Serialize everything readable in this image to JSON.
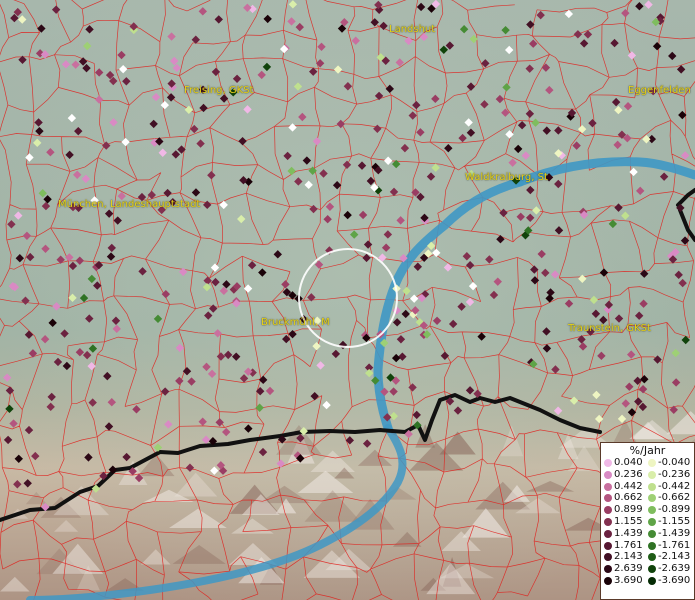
{
  "map": {
    "places": [
      {
        "name": "Landshut"
      },
      {
        "name": "Freising, GKSt"
      },
      {
        "name": "Eggenfelden"
      },
      {
        "name": "Waldkraiburg, St"
      },
      {
        "name": "München, Landeshauptstadt"
      },
      {
        "name": "Bruckmühl, M"
      },
      {
        "name": "Traunstein, GKSt"
      }
    ],
    "colors": {
      "background": "#9fb2a6",
      "district_lines": "#e0201c",
      "border_line": "#111111",
      "river": "#3f98c4",
      "label": "#e6d21a",
      "selection_circle": "#ffffff"
    }
  },
  "legend": {
    "title": "%/Jahr",
    "rows": [
      {
        "pos": "0.040",
        "pos_color": "#f0b8e6",
        "neg": "-0.040",
        "neg_color": "#eef5c2"
      },
      {
        "pos": "0.236",
        "pos_color": "#d98ac4",
        "neg": "-0.236",
        "neg_color": "#d9eeaa"
      },
      {
        "pos": "0.442",
        "pos_color": "#c9709f",
        "neg": "-0.442",
        "neg_color": "#bfe08e"
      },
      {
        "pos": "0.662",
        "pos_color": "#b4557f",
        "neg": "-0.662",
        "neg_color": "#9ed075"
      },
      {
        "pos": "0.899",
        "pos_color": "#9a3d63",
        "neg": "-0.899",
        "neg_color": "#7fbd5e"
      },
      {
        "pos": "1.155",
        "pos_color": "#83304f",
        "neg": "-1.155",
        "neg_color": "#5fa447"
      },
      {
        "pos": "1.439",
        "pos_color": "#6b2240",
        "neg": "-1.439",
        "neg_color": "#458b34"
      },
      {
        "pos": "1.761",
        "pos_color": "#571832",
        "neg": "-1.761",
        "neg_color": "#2f7224"
      },
      {
        "pos": "2.143",
        "pos_color": "#421024",
        "neg": "-2.143",
        "neg_color": "#1f5c17"
      },
      {
        "pos": "2.639",
        "pos_color": "#2c0816",
        "neg": "-2.639",
        "neg_color": "#10430b"
      },
      {
        "pos": "3.690",
        "pos_color": "#1a0208",
        "neg": "-3.690",
        "neg_color": "#052b04"
      }
    ]
  }
}
